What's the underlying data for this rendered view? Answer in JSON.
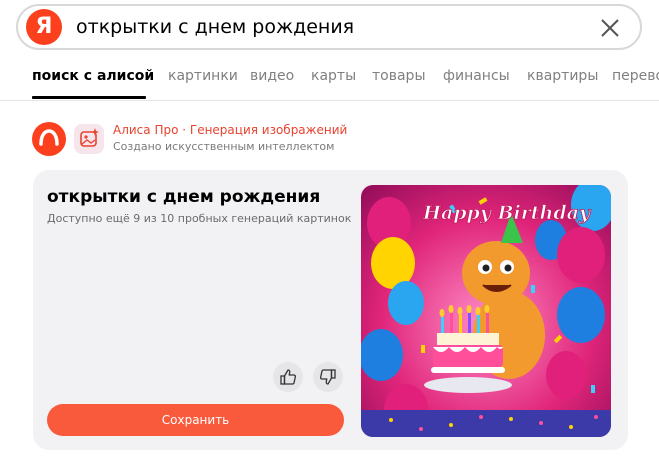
{
  "search": {
    "logo_letter": "Я",
    "query": "открытки с днем рождения"
  },
  "tabs": [
    {
      "label": "поиск с алисой",
      "active": true
    },
    {
      "label": "картинки"
    },
    {
      "label": "видео"
    },
    {
      "label": "карты"
    },
    {
      "label": "товары"
    },
    {
      "label": "финансы"
    },
    {
      "label": "квартиры"
    },
    {
      "label": "перевод"
    }
  ],
  "attribution": {
    "title": "Алиса Про · Генерация изображений",
    "subtitle": "Создано искусственным интеллектом"
  },
  "card": {
    "title": "открытки с днем рождения",
    "subtitle": "Доступно ещё 9 из 10 пробных генераций картинок",
    "save_label": "Сохранить",
    "image_text": "Happy Birthday"
  },
  "colors": {
    "brand": "#fc3f1d",
    "link": "#e8432f",
    "save_button": "#fa5a3c",
    "card_bg": "#f2f2f4"
  }
}
